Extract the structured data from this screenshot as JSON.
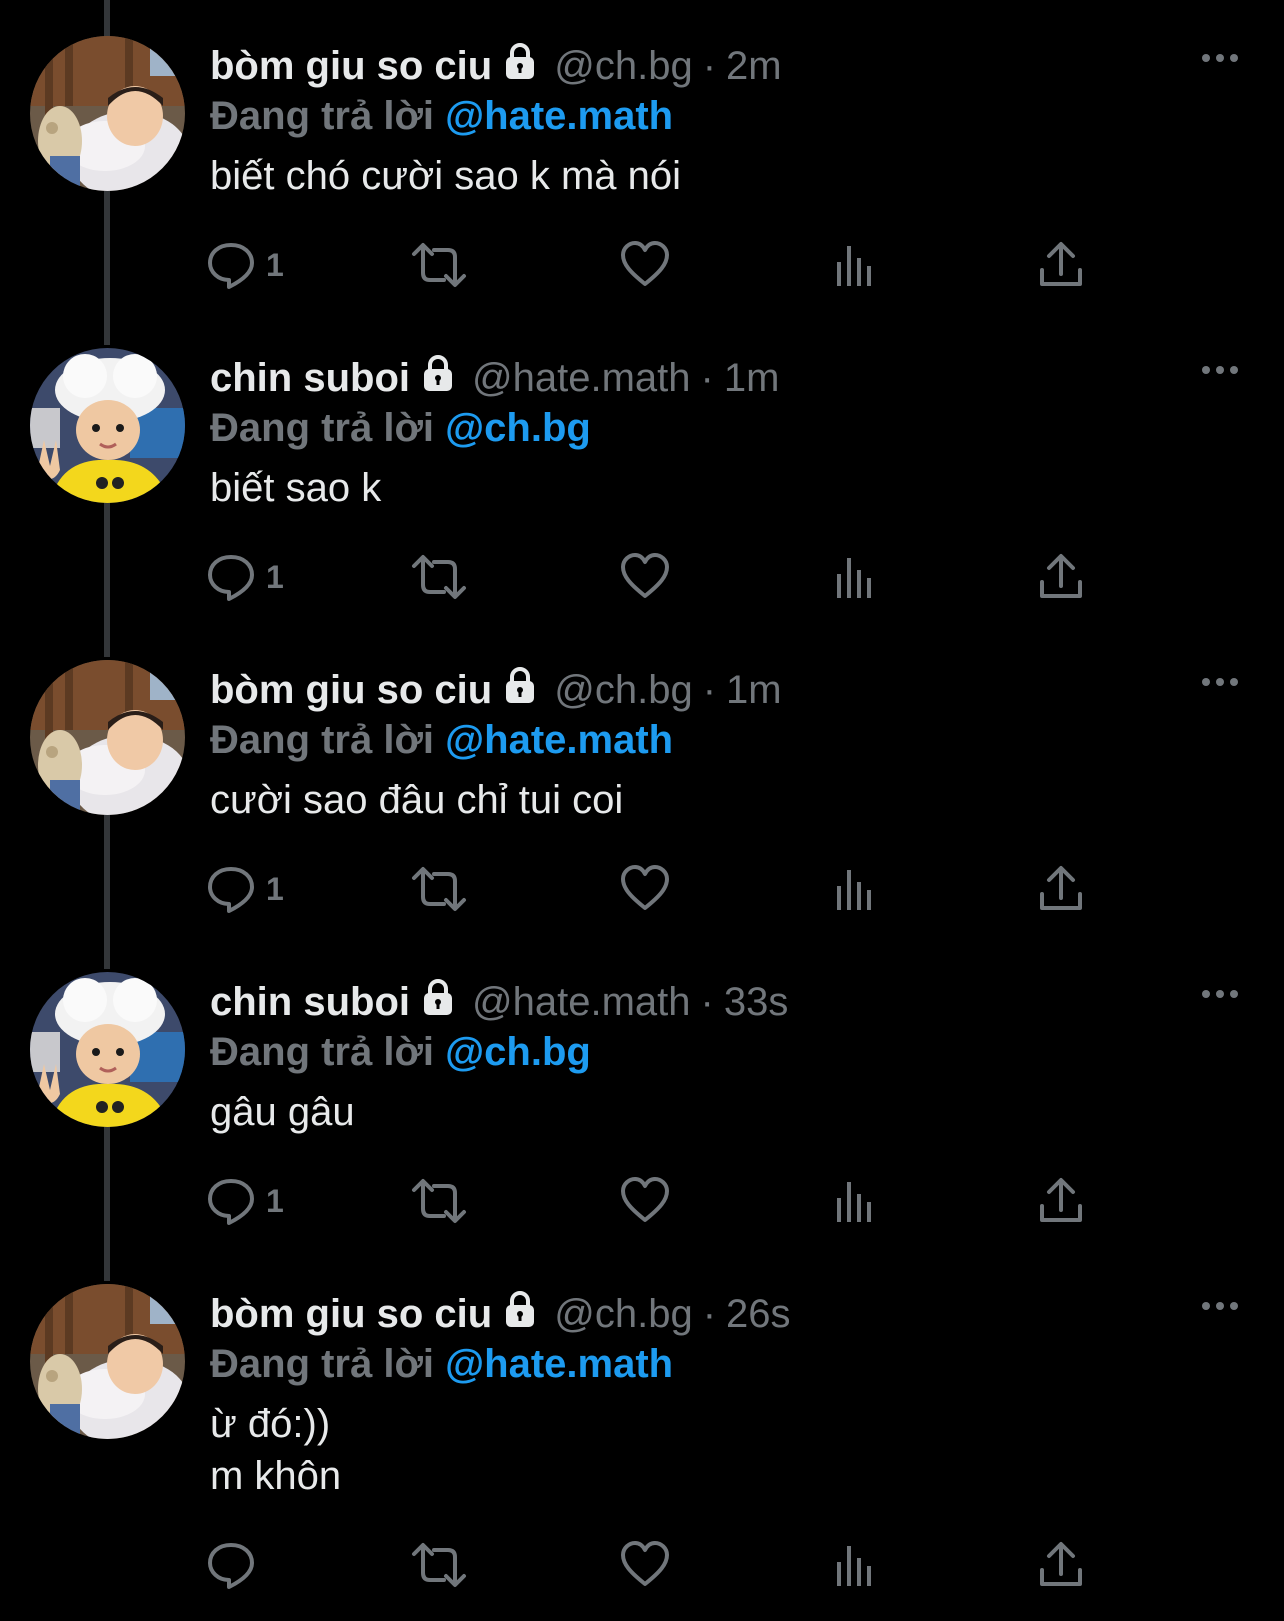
{
  "tweets": [
    {
      "name": "bòm giu so ciu",
      "handle": "@ch.bg",
      "time": "2m",
      "reply_prefix": "Đang trả lời",
      "reply_to": "@hate.math",
      "text": "biết chó cười sao k mà nói",
      "reply_count": "1",
      "avatar": "sleeping-child"
    },
    {
      "name": "chin suboi",
      "handle": "@hate.math",
      "time": "1m",
      "reply_prefix": "Đang trả lời",
      "reply_to": "@ch.bg",
      "text": "biết sao k",
      "reply_count": "1",
      "avatar": "child-chef-hat"
    },
    {
      "name": "bòm giu so ciu",
      "handle": "@ch.bg",
      "time": "1m",
      "reply_prefix": "Đang trả lời",
      "reply_to": "@hate.math",
      "text": "cười sao đâu chỉ tui coi",
      "reply_count": "1",
      "avatar": "sleeping-child"
    },
    {
      "name": "chin suboi",
      "handle": "@hate.math",
      "time": "33s",
      "reply_prefix": "Đang trả lời",
      "reply_to": "@ch.bg",
      "text": "gâu gâu",
      "reply_count": "1",
      "avatar": "child-chef-hat"
    },
    {
      "name": "bòm giu so ciu",
      "handle": "@ch.bg",
      "time": "26s",
      "reply_prefix": "Đang trả lời",
      "reply_to": "@hate.math",
      "text": "ừ đó:))\nm khôn",
      "reply_count": "",
      "avatar": "sleeping-child"
    }
  ],
  "icons": {
    "protected": "lock-icon",
    "more": "more-icon",
    "reply": "reply-icon",
    "retweet": "retweet-icon",
    "like": "heart-icon",
    "views": "views-icon",
    "share": "share-icon"
  },
  "colors": {
    "background": "#000000",
    "text": "#e7e9ea",
    "muted": "#71767b",
    "mention": "#1d9bf0",
    "thread_line": "#333639"
  }
}
